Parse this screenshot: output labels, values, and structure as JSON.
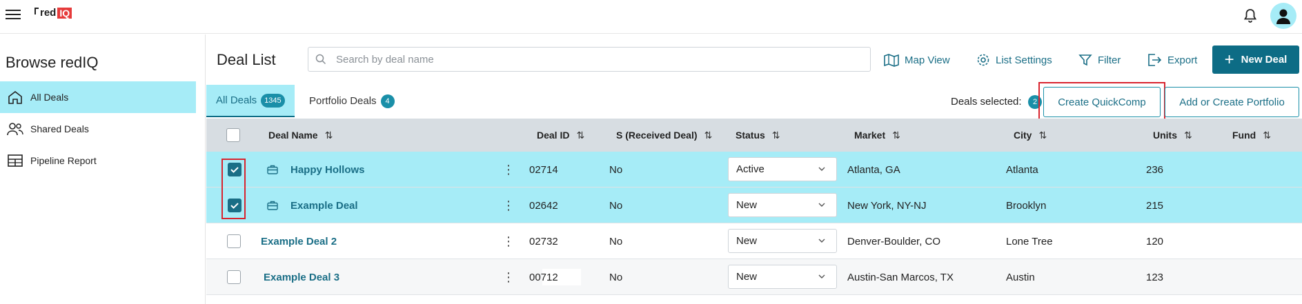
{
  "app": {
    "logo_text": "red",
    "logo_badge": "IQ"
  },
  "sidebar": {
    "title": "Browse redIQ",
    "items": [
      {
        "label": "All Deals",
        "icon": "home-icon",
        "active": true
      },
      {
        "label": "Shared Deals",
        "icon": "users-icon",
        "active": false
      },
      {
        "label": "Pipeline Report",
        "icon": "table-icon",
        "active": false
      }
    ]
  },
  "header": {
    "title": "Deal List",
    "search_placeholder": "Search by deal name",
    "map_view": "Map View",
    "list_settings": "List Settings",
    "filter": "Filter",
    "export": "Export",
    "new_deal": "New Deal"
  },
  "tabs": [
    {
      "label": "All Deals",
      "count": "1345",
      "active": true
    },
    {
      "label": "Portfolio Deals",
      "count": "4",
      "active": false
    }
  ],
  "selection": {
    "label": "Deals selected:",
    "count": "2",
    "create_quickcomp": "Create QuickComp",
    "add_portfolio": "Add or Create Portfolio"
  },
  "table": {
    "columns": [
      "Deal Name",
      "Deal ID",
      "S (Received Deal)",
      "Status",
      "Market",
      "City",
      "Units",
      "Fund"
    ],
    "rows": [
      {
        "name": "Happy Hollows",
        "id": "02714",
        "received": "No",
        "status": "Active",
        "market": "Atlanta, GA",
        "city": "Atlanta",
        "units": "236",
        "checked": true
      },
      {
        "name": "Example Deal",
        "id": "02642",
        "received": "No",
        "status": "New",
        "market": "New York, NY-NJ",
        "city": "Brooklyn",
        "units": "215",
        "checked": true
      },
      {
        "name": "Example Deal 2",
        "id": "02732",
        "received": "No",
        "status": "New",
        "market": "Denver-Boulder, CO",
        "city": "Lone Tree",
        "units": "120",
        "checked": false
      },
      {
        "name": "Example Deal 3",
        "id": "00712",
        "received": "No",
        "status": "New",
        "market": "Austin-San Marcos, TX",
        "city": "Austin",
        "units": "123",
        "checked": false
      }
    ]
  },
  "colors": {
    "accent": "#0d6c85",
    "highlight_row": "#a6ecf7",
    "callout": "#d9232e"
  }
}
